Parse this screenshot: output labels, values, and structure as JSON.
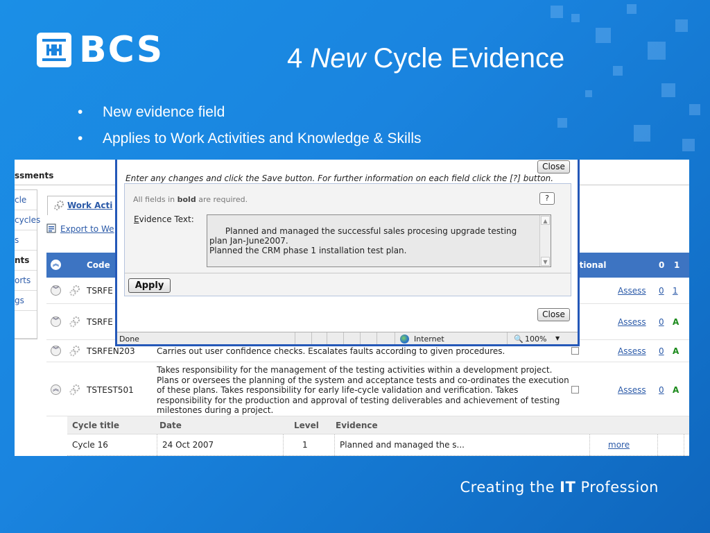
{
  "slide": {
    "logo_text": "BCS",
    "title_prefix": "4 ",
    "title_em": "New",
    "title_suffix": " Cycle Evidence",
    "bullets": [
      "New evidence field",
      "Applies to Work Activities and Knowledge & Skills"
    ],
    "bullet_glyph": "•",
    "footer_pre": "Creating the ",
    "footer_bold": "IT",
    "footer_post": " Profession"
  },
  "app": {
    "section_title": "ssments",
    "side_nav": [
      "cle",
      "cycles",
      "s",
      "nts",
      "orts",
      "gs"
    ],
    "work_tab": "Work Acti",
    "export_link": "Export to We",
    "table": {
      "headers": {
        "code": "Code",
        "optional": "ptional",
        "c0": "0",
        "c1": "1"
      },
      "rows": [
        {
          "code": "TSRFE",
          "desc": "",
          "assess": "Assess",
          "v0": "0",
          "v1": "1"
        },
        {
          "code": "TSRFE",
          "desc": "",
          "assess": "Assess",
          "v0": "0",
          "v1": "A"
        },
        {
          "code": "TSRFEN203",
          "desc": "Carries out user confidence checks. Escalates faults according to given procedures.",
          "assess": "Assess",
          "v0": "0",
          "v1": "A"
        },
        {
          "code": "TSTEST501",
          "desc": "Takes responsibility for the management of the testing activities within a development project. Plans or oversees the planning of the system and acceptance tests and co-ordinates the execution of these plans. Takes responsibility for early life-cycle validation and verification. Takes responsibility for the production and approval of testing deliverables and achievement of testing milestones during a project.",
          "assess": "Assess",
          "v0": "0",
          "v1": "A"
        }
      ],
      "sub_headers": {
        "cycle_title": "Cycle title",
        "date": "Date",
        "level": "Level",
        "evidence": "Evidence"
      },
      "sub_row": {
        "cycle_title": "Cycle 16",
        "date": "24 Oct 2007",
        "level": "1",
        "evidence": "Planned and managed the s...",
        "more": "more"
      }
    }
  },
  "popup": {
    "close_label": "Close",
    "intro": "Enter any changes and click the Save button. For further information on each field click the [?] button.",
    "req_pre": "All fields in ",
    "req_bold": "bold",
    "req_post": " are required.",
    "help_label": "?",
    "evidence_label_u": "E",
    "evidence_label_rest": "vidence Text:",
    "evidence_value": "Planned and managed the successful sales procesing upgrade testing plan Jan-June2007.\nPlanned the CRM phase 1 installation test plan.",
    "apply_label": "Apply",
    "status_left": "Done",
    "status_zone": "Internet",
    "status_zoom": "100%"
  },
  "colors": {
    "background": "#1a84df",
    "table_header": "#3d74c2",
    "link": "#2b5aa8",
    "popup_border": "#2458b8",
    "status_A": "#1c8a1c"
  }
}
